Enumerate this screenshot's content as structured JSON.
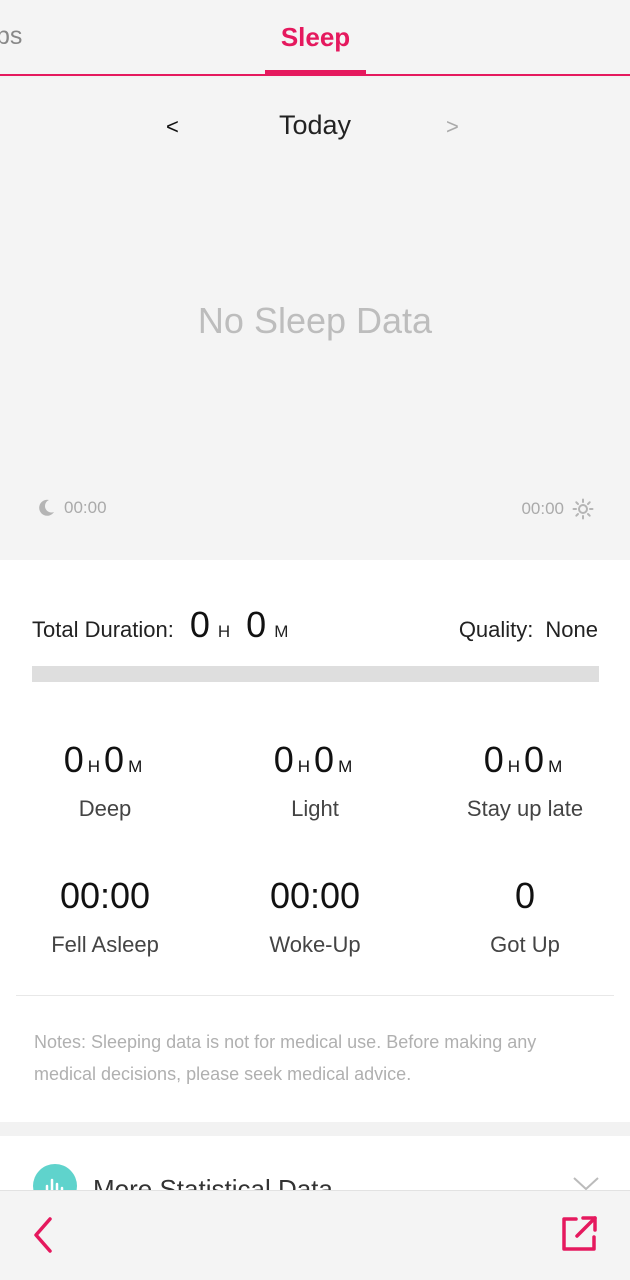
{
  "tabs": {
    "prev_fragment": "ps",
    "active": "Sleep"
  },
  "date_nav": {
    "prev": "<",
    "label": "Today",
    "next": ">"
  },
  "chart": {
    "empty_message": "No Sleep Data",
    "start_time": "00:00",
    "end_time": "00:00"
  },
  "summary": {
    "total_label": "Total Duration:",
    "total_hours": "0",
    "hour_unit": "H",
    "total_minutes": "0",
    "minute_unit": "M",
    "quality_label": "Quality:",
    "quality_value": "None",
    "progress_fraction": 0
  },
  "stats": [
    {
      "hours": "0",
      "minutes": "0",
      "label": "Deep"
    },
    {
      "hours": "0",
      "minutes": "0",
      "label": "Light"
    },
    {
      "hours": "0",
      "minutes": "0",
      "label": "Stay up late"
    }
  ],
  "times": [
    {
      "value": "00:00",
      "label": "Fell Asleep"
    },
    {
      "value": "00:00",
      "label": "Woke-Up"
    },
    {
      "value": "0",
      "label": "Got Up"
    }
  ],
  "notes": "Notes: Sleeping data is not for medical use. Before making any medical decisions, please seek medical advice.",
  "more": {
    "label": "More Statistical Data"
  },
  "colors": {
    "accent": "#e5195e",
    "icon_teal": "#5fd3cc"
  }
}
